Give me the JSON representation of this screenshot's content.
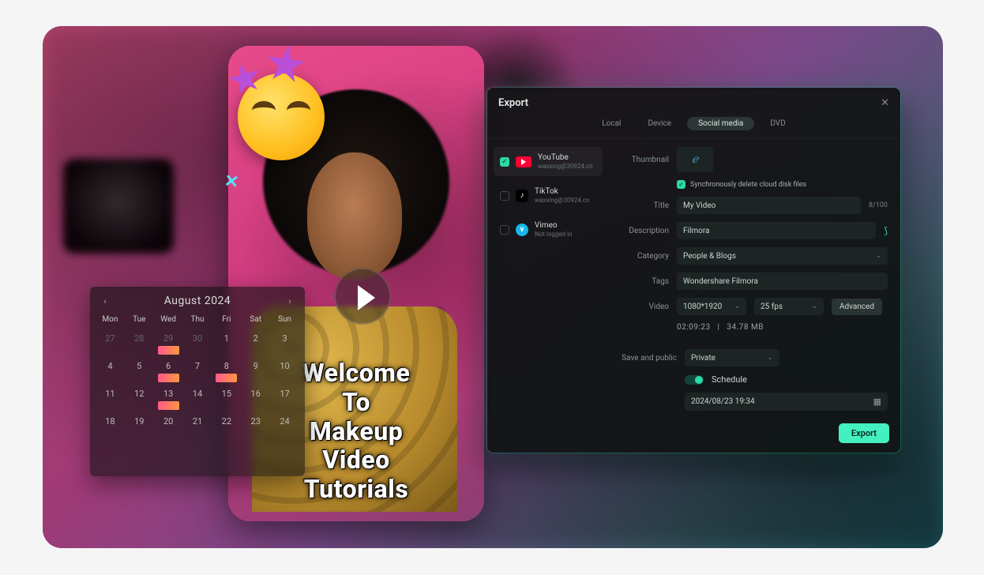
{
  "video": {
    "caption_line1": "Welcome To",
    "caption_line2": "Makeup Video",
    "caption_line3": "Tutorials"
  },
  "calendar": {
    "title": "August  2024",
    "prev": "‹",
    "next": "›",
    "dow": [
      "Mon",
      "Tue",
      "Wed",
      "Thu",
      "Fri",
      "Sat",
      "Sun"
    ],
    "cells": [
      {
        "n": "27",
        "out": true
      },
      {
        "n": "28",
        "out": true
      },
      {
        "n": "29",
        "out": true,
        "thumb": true
      },
      {
        "n": "30",
        "out": true
      },
      {
        "n": "1"
      },
      {
        "n": "2"
      },
      {
        "n": "3"
      },
      {
        "n": "4"
      },
      {
        "n": "5"
      },
      {
        "n": "6",
        "thumb": true
      },
      {
        "n": "7"
      },
      {
        "n": "8",
        "thumb": true
      },
      {
        "n": "9"
      },
      {
        "n": "10"
      },
      {
        "n": "11"
      },
      {
        "n": "12"
      },
      {
        "n": "13",
        "thumb": true
      },
      {
        "n": "14"
      },
      {
        "n": "15"
      },
      {
        "n": "16"
      },
      {
        "n": "17"
      },
      {
        "n": "18"
      },
      {
        "n": "19"
      },
      {
        "n": "20"
      },
      {
        "n": "21"
      },
      {
        "n": "22"
      },
      {
        "n": "23"
      },
      {
        "n": "24"
      }
    ]
  },
  "export": {
    "title": "Export",
    "close": "✕",
    "tabs": {
      "local": "Local",
      "device": "Device",
      "social": "Social media",
      "dvd": "DVD"
    },
    "platforms": [
      {
        "key": "youtube",
        "name": "YouTube",
        "sub": "waxxing@30924.cn",
        "checked": true
      },
      {
        "key": "tiktok",
        "name": "TikTok",
        "sub": "waxxing@30924.cn",
        "checked": false
      },
      {
        "key": "vimeo",
        "name": "Vimeo",
        "sub": "Not logged in",
        "checked": false
      }
    ],
    "labels": {
      "thumbnail": "Thumbnail",
      "sync": "Synchronously delete cloud disk files",
      "title": "Title",
      "description": "Description",
      "category": "Category",
      "tags": "Tags",
      "video": "Video",
      "advanced": "Advanced",
      "save_and": "Save and public",
      "schedule": "Schedule",
      "export_btn": "Export"
    },
    "values": {
      "title": "My Video",
      "title_count": "8/100",
      "description": "Filmora",
      "category": "People & Blogs",
      "tags": "Wondershare Filmora",
      "resolution": "1080*1920",
      "fps": "25 fps",
      "duration": "02:09:23",
      "size": "34.78 MB",
      "privacy": "Private",
      "schedule": "2024/08/23  19:34"
    }
  }
}
